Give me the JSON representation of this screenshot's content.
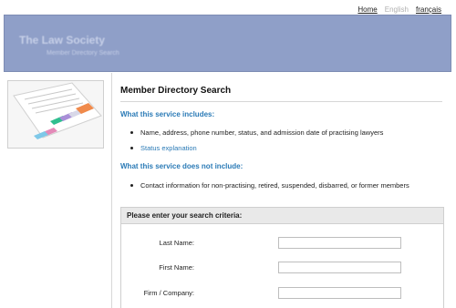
{
  "topnav": {
    "home": "Home",
    "english": "English",
    "francais": "français"
  },
  "banner": {
    "title": "The Law Society",
    "subtitle": "Member Directory Search"
  },
  "main": {
    "title": "Member Directory Search",
    "includes_heading": "What this service includes:",
    "includes": [
      "Name, address, phone number, status, and admission date of practising lawyers",
      "Status explanation"
    ],
    "excludes_heading": "What this service does not include:",
    "excludes": [
      "Contact information for non-practising, retired, suspended, disbarred, or former members"
    ]
  },
  "search": {
    "heading": "Please enter your search criteria:",
    "last_name_label": "Last Name:",
    "first_name_label": "First Name:",
    "firm_label": "Firm / Company:",
    "last_name_value": "",
    "first_name_value": "",
    "firm_value": ""
  }
}
